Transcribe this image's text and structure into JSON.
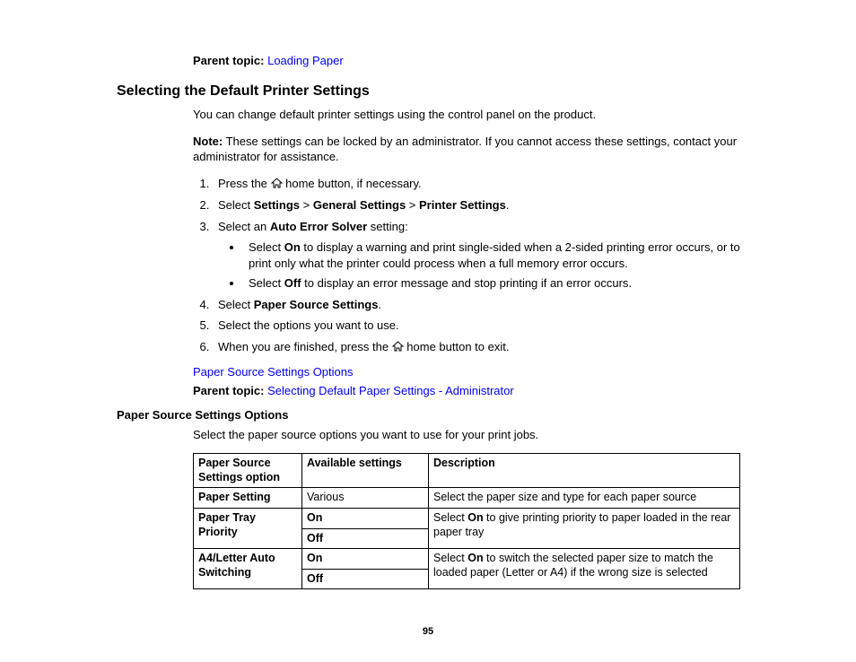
{
  "parentTopic1": {
    "label": "Parent topic:",
    "link": "Loading Paper"
  },
  "sectionTitle": "Selecting the Default Printer Settings",
  "intro": "You can change default printer settings using the control panel on the product.",
  "noteLabel": "Note:",
  "noteText": " These settings can be locked by an administrator. If you cannot access these settings, contact your administrator for assistance.",
  "steps": {
    "s1a": "Press the ",
    "s1b": " home button, if necessary.",
    "s2a": "Select ",
    "s2b": "Settings",
    "s2c": " > ",
    "s2d": "General Settings",
    "s2e": " > ",
    "s2f": "Printer Settings",
    "s2g": ".",
    "s3a": "Select an ",
    "s3b": "Auto Error Solver",
    "s3c": " setting:",
    "s3sub1a": "Select ",
    "s3sub1b": "On",
    "s3sub1c": " to display a warning and print single-sided when a 2-sided printing error occurs, or to print only what the printer could process when a full memory error occurs.",
    "s3sub2a": "Select ",
    "s3sub2b": "Off",
    "s3sub2c": " to display an error message and stop printing if an error occurs.",
    "s4a": "Select ",
    "s4b": "Paper Source Settings",
    "s4c": ".",
    "s5": "Select the options you want to use.",
    "s6a": "When you are finished, press the ",
    "s6b": " home button to exit."
  },
  "relatedLink": "Paper Source Settings Options",
  "parentTopic2": {
    "label": "Parent topic:",
    "link": "Selecting Default Paper Settings - Administrator"
  },
  "subsection": "Paper Source Settings Options",
  "subIntro": "Select the paper source options you want to use for your print jobs.",
  "table": {
    "h1": "Paper Source Settings option",
    "h2": "Available settings",
    "h3": "Description",
    "r1c1": "Paper Setting",
    "r1c2": "Various",
    "r1c3": "Select the paper size and type for each paper source",
    "r2c1": "Paper Tray Priority",
    "r2c2a": "On",
    "r2c2b": "Off",
    "r2c3a": "Select ",
    "r2c3b": "On",
    "r2c3c": " to give printing priority to paper loaded in the rear paper tray",
    "r3c1": "A4/Letter Auto Switching",
    "r3c2a": "On",
    "r3c2b": "Off",
    "r3c3a": "Select ",
    "r3c3b": "On",
    "r3c3c": " to switch the selected paper size to match the loaded paper (Letter or A4) if the wrong size is selected"
  },
  "pageNumber": "95"
}
